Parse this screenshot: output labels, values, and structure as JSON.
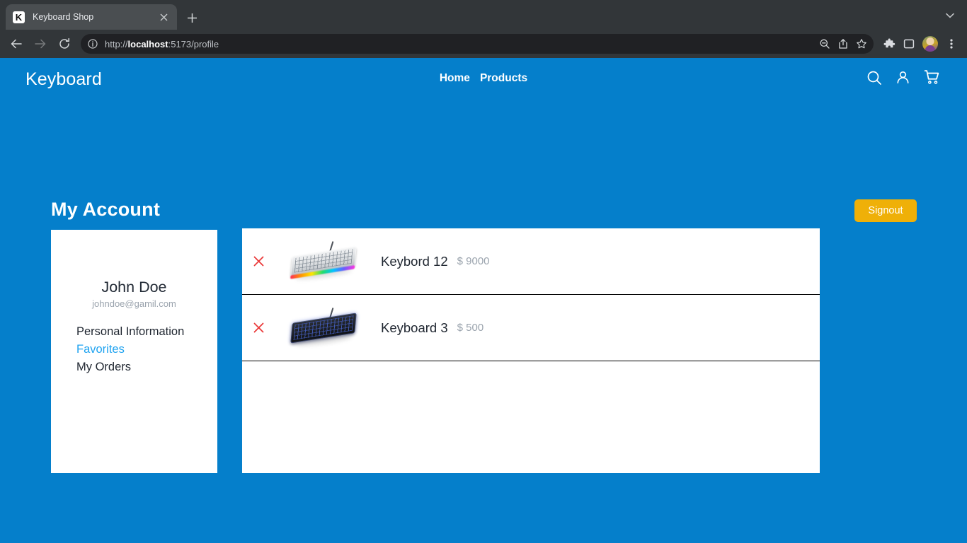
{
  "browser": {
    "tab": {
      "title": "Keyboard Shop",
      "favicon_letter": "K",
      "close_icon": "close-icon"
    },
    "new_tab_label": "+",
    "tabstrip_chevron": "chevron-down-icon",
    "nav": {
      "back": "back-icon",
      "forward": "forward-icon",
      "reload": "reload-icon"
    },
    "omnibox": {
      "info_icon": "site-info-icon",
      "url_scheme": "http://",
      "url_host": "localhost",
      "url_rest": ":5173/profile",
      "zoom_icon": "zoom-out-icon",
      "share_icon": "share-icon",
      "bookmark_icon": "star-icon"
    },
    "toolbar_icons": [
      "extensions-icon",
      "side-panel-icon",
      "profile-avatar",
      "chrome-menu-icon"
    ]
  },
  "site": {
    "brand": "Keyboard",
    "nav": [
      {
        "label": "Home",
        "name": "nav-home"
      },
      {
        "label": "Products",
        "name": "nav-products"
      }
    ],
    "header_icons": [
      "search-icon",
      "user-icon",
      "cart-icon"
    ],
    "colors": {
      "page_background": "#057FCB",
      "accent_blue": "#1FA3F0",
      "signout_yellow": "#EFB008",
      "remove_red": "#EA3A3A",
      "text_dark": "#1F2630",
      "text_muted": "#9AA3AD"
    }
  },
  "account": {
    "title": "My Account",
    "signout_label": "Signout",
    "profile": {
      "name": "John Doe",
      "email": "johndoe@gamil.com",
      "menu": [
        {
          "label": "Personal Information",
          "active": false
        },
        {
          "label": "Favorites",
          "active": true
        },
        {
          "label": "My Orders",
          "active": false
        }
      ]
    },
    "favorites": [
      {
        "remove_icon": "close-icon",
        "image": "keyboard-rgb-white-photo",
        "name": "Keybord 12",
        "price": "$ 9000"
      },
      {
        "remove_icon": "close-icon",
        "image": "keyboard-black-blue-photo",
        "name": "Keyboard 3",
        "price": "$ 500"
      }
    ]
  }
}
